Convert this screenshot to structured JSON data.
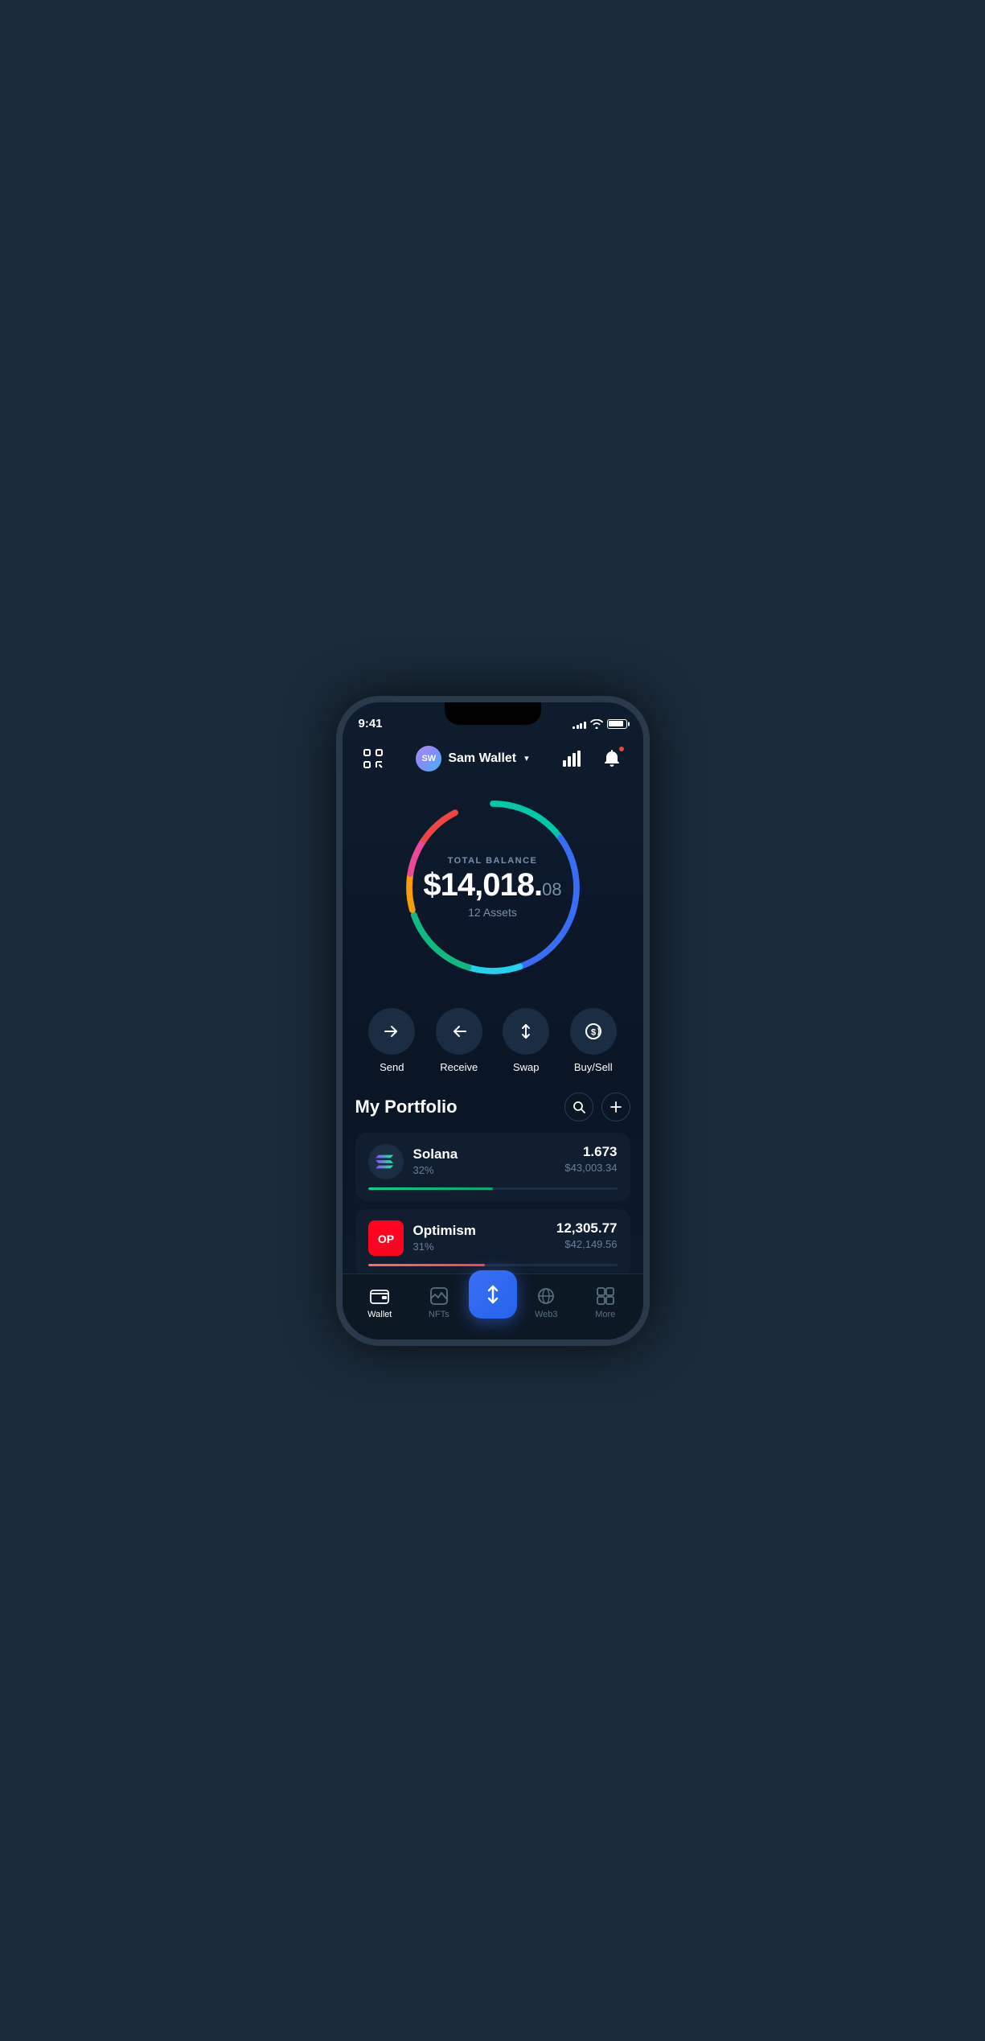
{
  "status": {
    "time": "9:41",
    "signal_bars": [
      3,
      5,
      7,
      9,
      11
    ],
    "battery_level": "90%"
  },
  "header": {
    "scan_label": "scan",
    "wallet_avatar_initials": "SW",
    "wallet_name": "Sam Wallet",
    "chevron": "▾",
    "chart_label": "chart",
    "bell_label": "notifications"
  },
  "balance": {
    "label": "TOTAL BALANCE",
    "amount_main": "$14,018.",
    "amount_cents": "08",
    "assets_count": "12 Assets"
  },
  "actions": [
    {
      "id": "send",
      "label": "Send"
    },
    {
      "id": "receive",
      "label": "Receive"
    },
    {
      "id": "swap",
      "label": "Swap"
    },
    {
      "id": "buysell",
      "label": "Buy/Sell"
    }
  ],
  "portfolio": {
    "title": "My Portfolio",
    "search_label": "search",
    "add_label": "add"
  },
  "assets": [
    {
      "name": "Solana",
      "percent": "32%",
      "amount": "1.673",
      "value": "$43,003.34",
      "progress": 50,
      "color": "#00d68f"
    },
    {
      "name": "Optimism",
      "percent": "31%",
      "amount": "12,305.77",
      "value": "$42,149.56",
      "progress": 47,
      "color": "#ff4444"
    }
  ],
  "nav": {
    "items": [
      {
        "id": "wallet",
        "label": "Wallet",
        "active": true
      },
      {
        "id": "nfts",
        "label": "NFTs",
        "active": false
      },
      {
        "id": "center",
        "label": "",
        "active": false
      },
      {
        "id": "web3",
        "label": "Web3",
        "active": false
      },
      {
        "id": "more",
        "label": "More",
        "active": false
      }
    ]
  },
  "donut": {
    "segments": [
      {
        "color": "#00c9a7",
        "offset": 0,
        "length": 60
      },
      {
        "color": "#3b82f6",
        "offset": 60,
        "length": 120
      },
      {
        "color": "#22d3ee",
        "offset": 180,
        "length": 40
      },
      {
        "color": "#f59e0b",
        "offset": 220,
        "length": 30
      },
      {
        "color": "#ec4899",
        "offset": 250,
        "length": 30
      },
      {
        "color": "#ef4444",
        "offset": 280,
        "length": 40
      },
      {
        "color": "#00e5ff",
        "offset": 320,
        "length": 20
      },
      {
        "color": "#10b981",
        "offset": 340,
        "length": 20
      }
    ]
  }
}
